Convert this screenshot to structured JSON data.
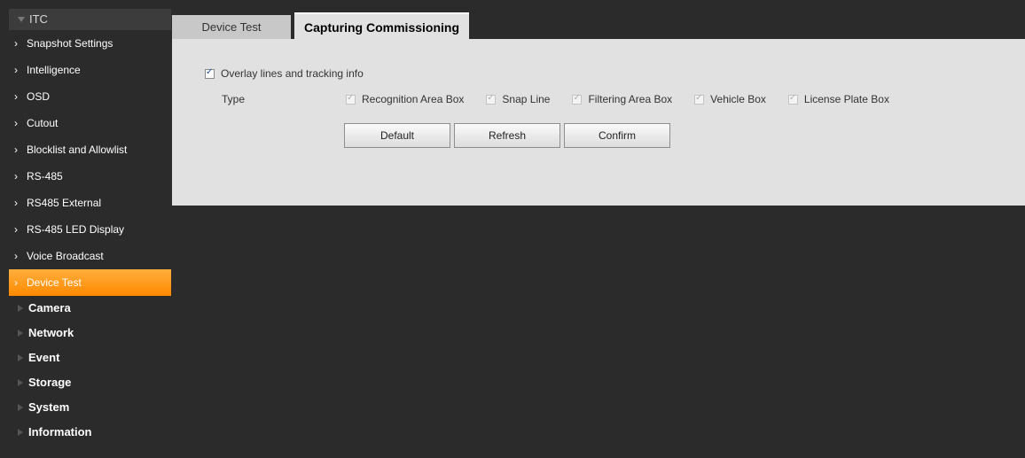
{
  "sidebar": {
    "itc_label": "ITC",
    "items": [
      {
        "label": "Snapshot Settings"
      },
      {
        "label": "Intelligence"
      },
      {
        "label": "OSD"
      },
      {
        "label": "Cutout"
      },
      {
        "label": "Blocklist and Allowlist"
      },
      {
        "label": "RS-485"
      },
      {
        "label": "RS485 External"
      },
      {
        "label": "RS-485 LED Display"
      },
      {
        "label": "Voice Broadcast"
      },
      {
        "label": "Device Test"
      }
    ],
    "active_item": "Device Test",
    "sections": [
      {
        "label": "Camera"
      },
      {
        "label": "Network"
      },
      {
        "label": "Event"
      },
      {
        "label": "Storage"
      },
      {
        "label": "System"
      },
      {
        "label": "Information"
      }
    ]
  },
  "tabs": [
    {
      "label": "Device Test",
      "active": false
    },
    {
      "label": "Capturing Commissioning",
      "active": true
    }
  ],
  "form": {
    "overlay_label": "Overlay lines and tracking info",
    "overlay_checked": true,
    "type_label": "Type",
    "type_options": [
      {
        "label": "Recognition Area Box",
        "checked": true
      },
      {
        "label": "Snap Line",
        "checked": true
      },
      {
        "label": "Filtering Area Box",
        "checked": true
      },
      {
        "label": "Vehicle Box",
        "checked": true
      },
      {
        "label": "License Plate Box",
        "checked": true
      }
    ]
  },
  "buttons": {
    "default_label": "Default",
    "refresh_label": "Refresh",
    "confirm_label": "Confirm"
  },
  "colors": {
    "active_item": "#ff9a1f",
    "background": "#2b2b2b",
    "panel": "#e1e1e1"
  }
}
